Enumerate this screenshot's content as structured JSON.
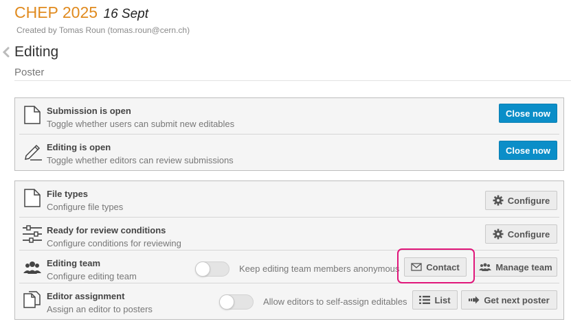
{
  "header": {
    "event_title": "CHEP 2025",
    "event_date": "16 Sept",
    "creator": "Created by Tomas Roun (tomas.roun@cern.ch)"
  },
  "page": {
    "title": "Editing",
    "subtitle": "Poster"
  },
  "status_section": [
    {
      "title": "Submission is open",
      "description": "Toggle whether users can submit new editables",
      "button": "Close now",
      "icon": "file-icon"
    },
    {
      "title": "Editing is open",
      "description": "Toggle whether editors can review submissions",
      "button": "Close now",
      "icon": "pencil-icon"
    }
  ],
  "settings_section": {
    "file_types": {
      "title": "File types",
      "description": "Configure file types",
      "button": "Configure",
      "icon": "file-icon"
    },
    "review_conditions": {
      "title": "Ready for review conditions",
      "description": "Configure conditions for reviewing",
      "button": "Configure",
      "icon": "sliders-icon"
    },
    "editing_team": {
      "title": "Editing team",
      "description": "Configure editing team",
      "toggle_label": "Keep editing team members anonymous",
      "toggle_on": false,
      "contact_button": "Contact",
      "manage_button": "Manage team",
      "icon": "users-icon"
    },
    "editor_assignment": {
      "title": "Editor assignment",
      "description": "Assign an editor to posters",
      "toggle_label": "Allow editors to self-assign editables",
      "toggle_on": false,
      "list_button": "List",
      "next_button": "Get next poster",
      "icon": "copy-icon"
    }
  },
  "colors": {
    "accent_orange": "#e08a1e",
    "primary_button": "#0b8ec8",
    "highlight_box": "#e0157a"
  }
}
